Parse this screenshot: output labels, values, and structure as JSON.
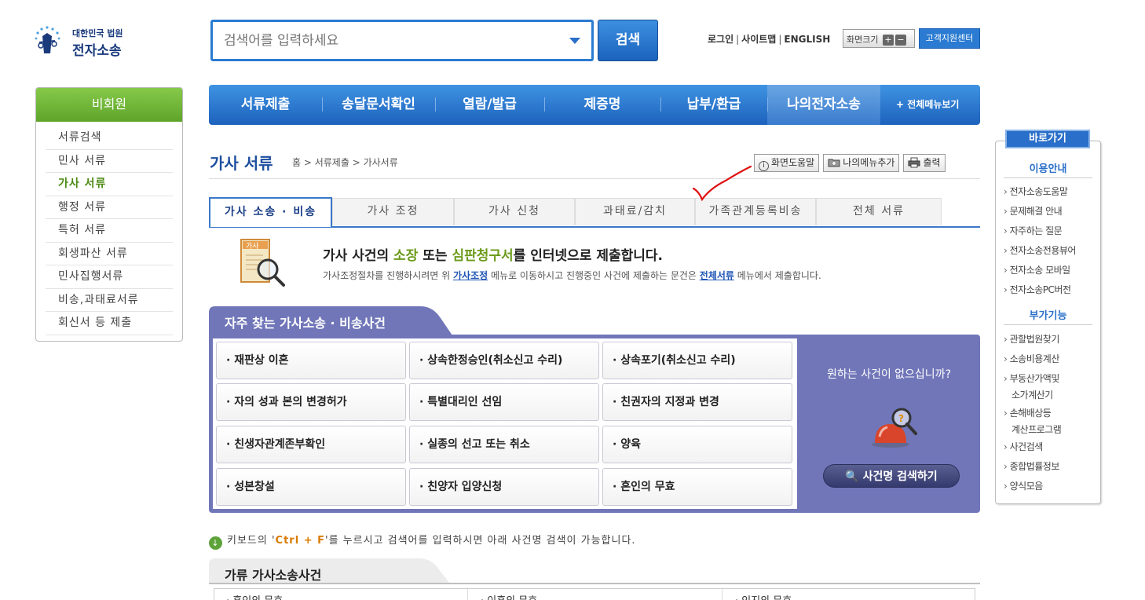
{
  "header": {
    "logo_small": "대한민국 법원",
    "logo_big": "전자소송",
    "search_placeholder": "검색어를 입력하세요",
    "search_button": "검색",
    "links": [
      "로그인",
      "사이트맵",
      "ENGLISH"
    ],
    "font_size_label": "화면크기",
    "font_plus": "+",
    "font_minus": "−",
    "support_label": "고객지원센터"
  },
  "sidebar": {
    "title": "비회원",
    "items": [
      "서류검색",
      "민사 서류",
      "가사 서류",
      "행정 서류",
      "특허 서류",
      "회생파산 서류",
      "민사집행서류",
      "비송,과태료서류",
      "회신서 등 제출"
    ],
    "active_index": 2
  },
  "main_nav": {
    "items": [
      "서류제출",
      "송달문서확인",
      "열람/발급",
      "제증명",
      "납부/환급",
      "나의전자소송"
    ],
    "selected_index": 5,
    "all_menu": "+ 전체메뉴보기"
  },
  "page": {
    "title": "가사 서류",
    "breadcrumb": "홈 > 서류제출 > 가사서류",
    "tools": {
      "help": "화면도움말",
      "add_menu": "나의메뉴추가",
      "print": "출력"
    }
  },
  "tabs": {
    "items": [
      "가사 소송 · 비송",
      "가사 조정",
      "가사 신청",
      "과태료/감치",
      "가족관계등록비송",
      "전체 서류"
    ],
    "selected_index": 0
  },
  "intro": {
    "icon_label": "가사",
    "heading_a": "가사 사건의 ",
    "heading_b": "소장",
    "heading_c": " 또는 ",
    "heading_d": "심판청구서",
    "heading_e": "를 인터넷으로 제출합니다.",
    "para_a": "가사조정절차를 진행하시려면 위 ",
    "para_link1": "가사조정",
    "para_b": " 메뉴로 이동하시고 진행중인 사건에 제출하는 문건은 ",
    "para_link2": "전체서류",
    "para_c": " 메뉴에서 제출합니다."
  },
  "frequent": {
    "title": "자주 찾는 가사소송 · 비송사건",
    "cells": [
      "· 재판상 이혼",
      "· 상속한정승인(취소신고 수리)",
      "· 상속포기(취소신고 수리)",
      "· 자의 성과 본의 변경허가",
      "· 특별대리인 선임",
      "· 친권자의 지정과 변경",
      "· 친생자관계존부확인",
      "· 실종의 선고 또는 취소",
      "· 양육",
      "· 성본창설",
      "· 친양자 입양신청",
      "· 혼인의 무효"
    ],
    "question": "원하는 사건이 없으십니까?",
    "search_button": "사건명 검색하기"
  },
  "hint": {
    "a": "키보드의 '",
    "key": "Ctrl + F",
    "b": "'를 누르시고 검색어를 입력하시면 아래 사건명 검색이 가능합니다."
  },
  "category": {
    "title": "가류 가사소송사건",
    "cells": [
      "· 혼인의 무효",
      "· 이혼의 무효",
      "· 인지의 무효"
    ]
  },
  "quick_panel": {
    "title": "바로가기",
    "section1": "이용안내",
    "links1": [
      "전자소송도움말",
      "문제해결 안내",
      "자주하는 질문",
      "전자소송전용뷰어",
      "전자소송 모바일",
      "전자소송PC버전"
    ],
    "section2": "부가기능",
    "links2": [
      "관할법원찾기",
      "소송비용계산",
      "부동산가액및",
      "소가계산기",
      "손해배상등",
      "계산프로그램",
      "사건검색",
      "종합법률정보",
      "양식모음"
    ]
  },
  "colors": {
    "primary_blue": "#2a6fc9",
    "green": "#5fa42a",
    "purple_panel": "#7076b8",
    "annotation_red": "#e01010"
  }
}
